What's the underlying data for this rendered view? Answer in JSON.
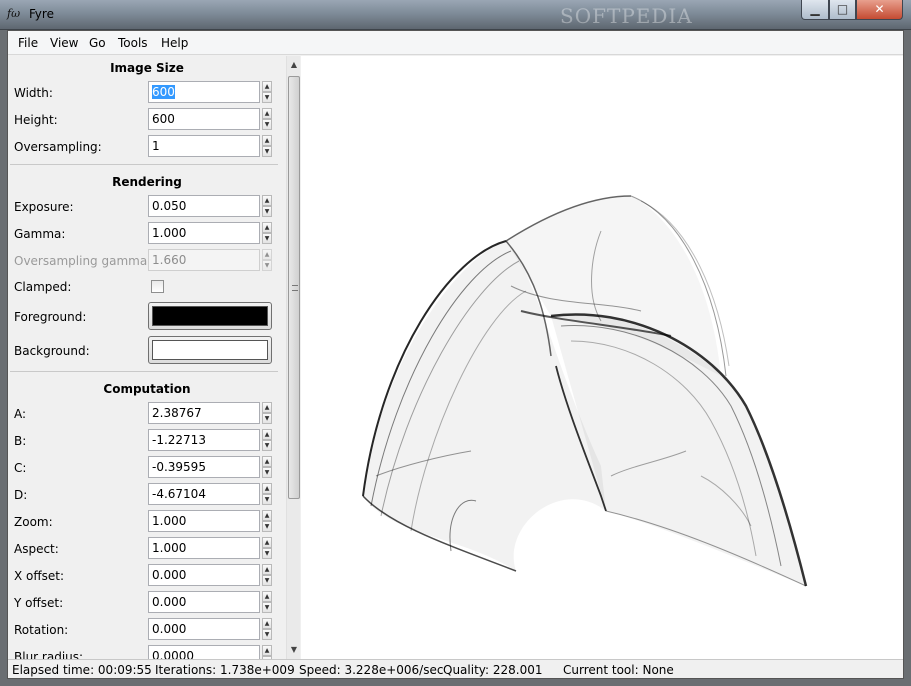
{
  "window": {
    "title": "Fyre",
    "icon_label": "fω",
    "watermark": "SOFTPEDIA",
    "buttons": {
      "minimize": "minimize-icon",
      "maximize": "maximize-icon",
      "close": "close-icon"
    }
  },
  "menu": [
    "File",
    "View",
    "Go",
    "Tools",
    "Help"
  ],
  "image_size": {
    "title": "Image Size",
    "width_label": "Width:",
    "width_value": "600",
    "height_label": "Height:",
    "height_value": "600",
    "oversampling_label": "Oversampling:",
    "oversampling_value": "1"
  },
  "rendering": {
    "title": "Rendering",
    "exposure_label": "Exposure:",
    "exposure_value": "0.050",
    "gamma_label": "Gamma:",
    "gamma_value": "1.000",
    "oversampling_gamma_label": "Oversampling gamma:",
    "oversampling_gamma_value": "1.660",
    "clamped_label": "Clamped:",
    "clamped_checked": false,
    "foreground_label": "Foreground:",
    "foreground_color": "#000000",
    "background_label": "Background:",
    "background_color": "#ffffff"
  },
  "computation": {
    "title": "Computation",
    "a_label": "A:",
    "a_value": "2.38767",
    "b_label": "B:",
    "b_value": "-1.22713",
    "c_label": "C:",
    "c_value": "-0.39595",
    "d_label": "D:",
    "d_value": "-4.67104",
    "zoom_label": "Zoom:",
    "zoom_value": "1.000",
    "aspect_label": "Aspect:",
    "aspect_value": "1.000",
    "xoffset_label": "X offset:",
    "xoffset_value": "0.000",
    "yoffset_label": "Y offset:",
    "yoffset_value": "0.000",
    "rotation_label": "Rotation:",
    "rotation_value": "0.000",
    "blur_label": "Blur radius:",
    "blur_value": "0.0000"
  },
  "status": {
    "elapsed": "Elapsed time: 00:09:55",
    "iterations": "Iterations: 1.738e+009",
    "speed": "Speed: 3.228e+006/sec",
    "quality": "Quality: 228.001",
    "tool": "Current tool: None"
  }
}
